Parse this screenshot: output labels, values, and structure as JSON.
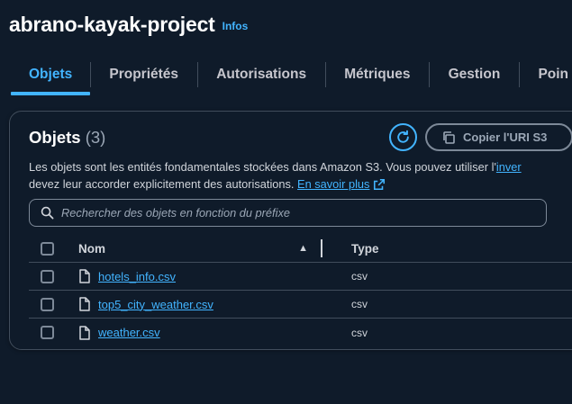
{
  "header": {
    "title": "abrano-kayak-project",
    "info_label": "Infos"
  },
  "tabs": [
    {
      "label": "Objets",
      "active": true
    },
    {
      "label": "Propriétés"
    },
    {
      "label": "Autorisations"
    },
    {
      "label": "Métriques"
    },
    {
      "label": "Gestion"
    },
    {
      "label": "Poin"
    }
  ],
  "objects_panel": {
    "title": "Objets",
    "count": "(3)",
    "copy_uri_label": "Copier l'URI S3",
    "description_line1": "Les objets sont les entités fondamentales stockées dans Amazon S3. Vous pouvez utiliser l'",
    "description_link1": "inver",
    "description_line2": "devez leur accorder explicitement des autorisations. ",
    "learn_more_label": "En savoir plus",
    "search_placeholder": "Rechercher des objets en fonction du préfixe"
  },
  "table": {
    "columns": {
      "name": "Nom",
      "type": "Type"
    },
    "rows": [
      {
        "name": "hotels_info.csv",
        "type": "csv"
      },
      {
        "name": "top5_city_weather.csv",
        "type": "csv"
      },
      {
        "name": "weather.csv",
        "type": "csv"
      }
    ]
  },
  "icons": {
    "refresh": "refresh-icon",
    "copy": "copy-icon",
    "external_link": "external-link-icon",
    "search": "search-icon",
    "sort": "sort-ascending-icon",
    "file": "file-icon"
  },
  "colors": {
    "background": "#0f1b2a",
    "accent": "#42b4ff",
    "border": "#414d5c",
    "text": "#d1d5db",
    "muted": "#9ba7b6"
  }
}
